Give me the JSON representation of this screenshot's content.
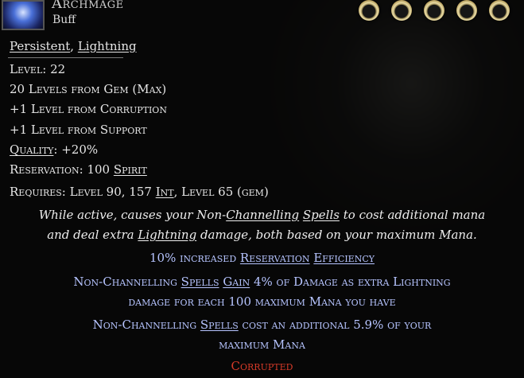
{
  "header": {
    "title": "Archmage",
    "subtitle": "Buff",
    "socket_count": 5
  },
  "tags": {
    "tag1": "Persistent",
    "separator": ", ",
    "tag2": "Lightning"
  },
  "stats": {
    "level_label": "Level: ",
    "level_value": "22",
    "gem_levels": "20 Levels from Gem (Max)",
    "corruption_levels": "+1 Level from Corruption",
    "support_levels": "+1 Level from Support",
    "quality_label": "Quality",
    "quality_value": ": +20%",
    "reservation_label": "Reservation: ",
    "reservation_value": "100 ",
    "reservation_unit": "Spirit",
    "requires_prefix": "Requires: Level 90, 157 ",
    "requires_int": "Int",
    "requires_suffix": ", Level 65 (gem)"
  },
  "description": {
    "l1_a": "While active, causes your ",
    "l1_b": "Non-",
    "l1_c": "Channelling",
    "l1_d": " ",
    "l1_e": "Spells",
    "l1_f": " to cost additional mana",
    "l2_a": "and deal extra ",
    "l2_b": "Lightning",
    "l2_c": " damage, both based on your maximum Mana."
  },
  "mods": {
    "m1_a": "10% increased ",
    "m1_b": "Reservation",
    "m1_c": " ",
    "m1_d": "Efficiency",
    "m2_a": "Non-Channelling ",
    "m2_b": "Spells",
    "m2_c": " ",
    "m2_d": "Gain",
    "m2_e": " 4% of Damage as extra Lightning",
    "m2_line2": "damage for each 100 maximum Mana you have",
    "m3_a": "Non-Channelling ",
    "m3_b": "Spells",
    "m3_c": " cost an additional 5.9% of your",
    "m3_line2": "maximum Mana"
  },
  "status": {
    "corrupted": "Corrupted"
  }
}
